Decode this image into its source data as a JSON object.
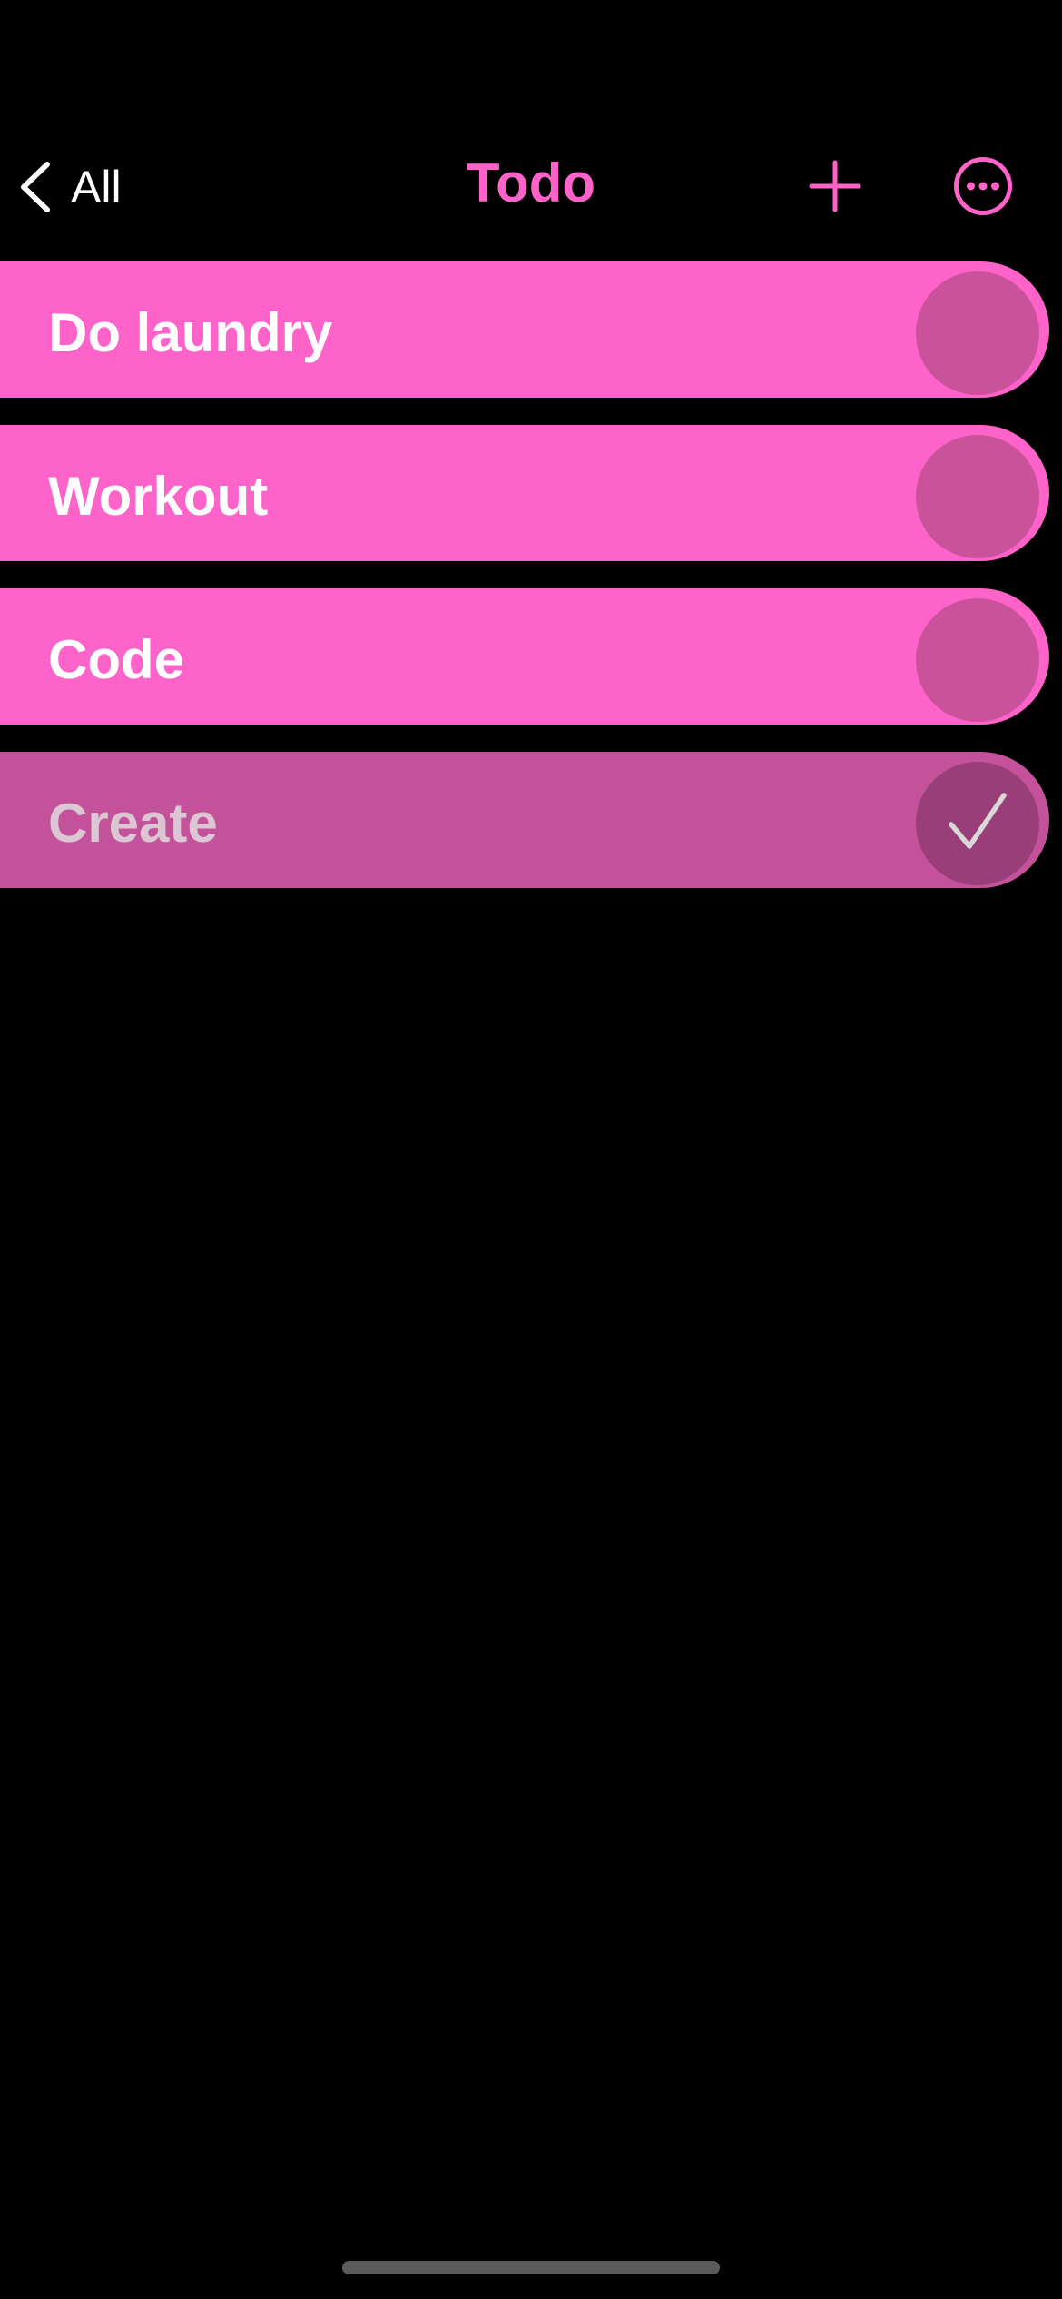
{
  "header": {
    "back_label": "All",
    "title": "Todo",
    "back_icon": "chevron-left-icon",
    "add_icon": "plus-icon",
    "more_icon": "ellipsis-circle-icon"
  },
  "tasks": [
    {
      "label": "Do laundry",
      "completed": false
    },
    {
      "label": "Workout",
      "completed": false
    },
    {
      "label": "Code",
      "completed": false
    },
    {
      "label": "Create",
      "completed": true
    }
  ],
  "colors": {
    "accent": "#ff63c9",
    "background": "#000000",
    "task_fill": "#fd63c8",
    "task_border": "#fd63c8",
    "check_fill": "#c9529b",
    "completed_fill": "#c4529a",
    "completed_check_fill": "#9a3e79",
    "completed_text": "#dcc6d3",
    "checkmark": "#d9d9d9"
  }
}
